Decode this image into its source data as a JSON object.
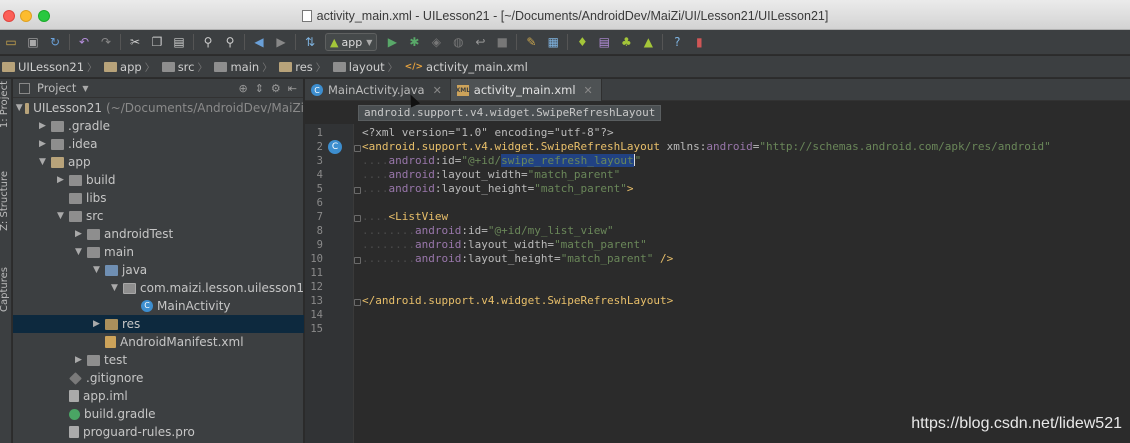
{
  "window": {
    "title": "activity_main.xml - UILesson21 - [~/Documents/AndroidDev/MaiZi/UI/Lesson21/UILesson21]"
  },
  "toolbar": {
    "run_config": "app",
    "help": "?"
  },
  "breadcrumb": [
    {
      "label": "UILesson21",
      "kind": "module"
    },
    {
      "label": "app",
      "kind": "module"
    },
    {
      "label": "src",
      "kind": "folder"
    },
    {
      "label": "main",
      "kind": "folder"
    },
    {
      "label": "res",
      "kind": "folder"
    },
    {
      "label": "layout",
      "kind": "folder"
    },
    {
      "label": "activity_main.xml",
      "kind": "xml"
    }
  ],
  "tool_windows": {
    "project_tab": "1: Project",
    "structure_tab": "Z: Structure",
    "captures_tab": "Captures"
  },
  "project_panel": {
    "header_label": "Project",
    "tree": [
      {
        "label": "UILesson21",
        "extra": "(~/Documents/AndroidDev/MaiZi",
        "indent": 0,
        "arrow": "open",
        "icon": "mod"
      },
      {
        "label": ".gradle",
        "indent": 1,
        "arrow": "closed",
        "icon": "folder"
      },
      {
        "label": ".idea",
        "indent": 1,
        "arrow": "closed",
        "icon": "folder"
      },
      {
        "label": "app",
        "indent": 1,
        "arrow": "open",
        "icon": "mod"
      },
      {
        "label": "build",
        "indent": 2,
        "arrow": "closed",
        "icon": "folder"
      },
      {
        "label": "libs",
        "indent": 2,
        "arrow": "none",
        "icon": "folder"
      },
      {
        "label": "src",
        "indent": 2,
        "arrow": "open",
        "icon": "folder"
      },
      {
        "label": "androidTest",
        "indent": 3,
        "arrow": "closed",
        "icon": "folder"
      },
      {
        "label": "main",
        "indent": 3,
        "arrow": "open",
        "icon": "folder"
      },
      {
        "label": "java",
        "indent": 4,
        "arrow": "open",
        "icon": "src"
      },
      {
        "label": "com.maizi.lesson.uilesson1",
        "indent": 5,
        "arrow": "open",
        "icon": "pkg"
      },
      {
        "label": "MainActivity",
        "indent": 6,
        "arrow": "none",
        "icon": "cls"
      },
      {
        "label": "res",
        "indent": 4,
        "arrow": "closed",
        "icon": "res",
        "selected": true
      },
      {
        "label": "AndroidManifest.xml",
        "indent": 4,
        "arrow": "none",
        "icon": "xml"
      },
      {
        "label": "test",
        "indent": 3,
        "arrow": "closed",
        "icon": "folder"
      },
      {
        "label": ".gitignore",
        "indent": 2,
        "arrow": "none",
        "icon": "git"
      },
      {
        "label": "app.iml",
        "indent": 2,
        "arrow": "none",
        "icon": "file"
      },
      {
        "label": "build.gradle",
        "indent": 2,
        "arrow": "none",
        "icon": "gradle"
      },
      {
        "label": "proguard-rules.pro",
        "indent": 2,
        "arrow": "none",
        "icon": "file"
      }
    ]
  },
  "editor_tabs": [
    {
      "label": "MainActivity.java",
      "icon": "C",
      "active": false
    },
    {
      "label": "activity_main.xml",
      "icon": "XML",
      "active": true
    }
  ],
  "editor": {
    "hint": "android.support.v4.widget.SwipeRefreshLayout",
    "gutter_icon": "C",
    "line_numbers": [
      "1",
      "2",
      "3",
      "4",
      "5",
      "6",
      "7",
      "8",
      "9",
      "10",
      "11",
      "12",
      "13",
      "14",
      "15"
    ],
    "lines": {
      "l1": "<?xml version=\"1.0\" encoding=\"utf-8\"?>",
      "l2_tag": "<android.support.v4.widget.SwipeRefreshLayout",
      "l2_attr": " xmlns:",
      "l2_ns": "android",
      "l2_eq": "=",
      "l2_val": "\"http://schemas.android.com/apk/res/android\"",
      "l3_ns": "android",
      "l3_attr": ":id=",
      "l3_val_a": "\"@+id/",
      "l3_sel": "swipe_refresh_layout",
      "l3_val_b": "\"",
      "l4_ns": "android",
      "l4_attr": ":layout_width=",
      "l4_val": "\"match_parent\"",
      "l5_ns": "android",
      "l5_attr": ":layout_height=",
      "l5_val": "\"match_parent\"",
      "l5_end": ">",
      "l7_tag": "<ListView",
      "l8_ns": "android",
      "l8_attr": ":id=",
      "l8_val": "\"@+id/my_list_view\"",
      "l9_ns": "android",
      "l9_attr": ":layout_width=",
      "l9_val": "\"match_parent\"",
      "l10_ns": "android",
      "l10_attr": ":layout_height=",
      "l10_val": "\"match_parent\"",
      "l10_end": " />",
      "l13_tag": "</android.support.v4.widget.SwipeRefreshLayout>"
    }
  },
  "watermark": "https://blog.csdn.net/lidew521"
}
